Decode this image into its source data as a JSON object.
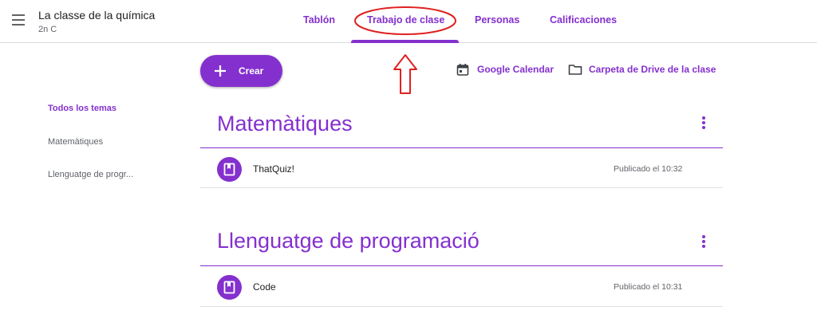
{
  "header": {
    "class_title": "La classe de la química",
    "class_section": "2n C",
    "tabs": [
      {
        "label": "Tablón"
      },
      {
        "label": "Trabajo de clase",
        "active": true
      },
      {
        "label": "Personas"
      },
      {
        "label": "Calificaciones"
      }
    ]
  },
  "toolbar": {
    "create_label": "Crear",
    "calendar_label": "Google Calendar",
    "drive_label": "Carpeta de Drive de la clase"
  },
  "sidebar": {
    "items": [
      {
        "label": "Todos los temas",
        "active": true
      },
      {
        "label": "Matemàtiques"
      },
      {
        "label": "Llenguatge de progr..."
      }
    ]
  },
  "topics": [
    {
      "title": "Matemàtiques",
      "items": [
        {
          "title": "ThatQuiz!",
          "date": "Publicado el 10:32",
          "icon": "assignment-icon"
        }
      ]
    },
    {
      "title": "Llenguatge de programació",
      "items": [
        {
          "title": "Code",
          "date": "Publicado el 10:31",
          "icon": "assignment-icon"
        }
      ]
    }
  ],
  "colors": {
    "accent": "#8430ce",
    "annotation": "#e02020"
  }
}
